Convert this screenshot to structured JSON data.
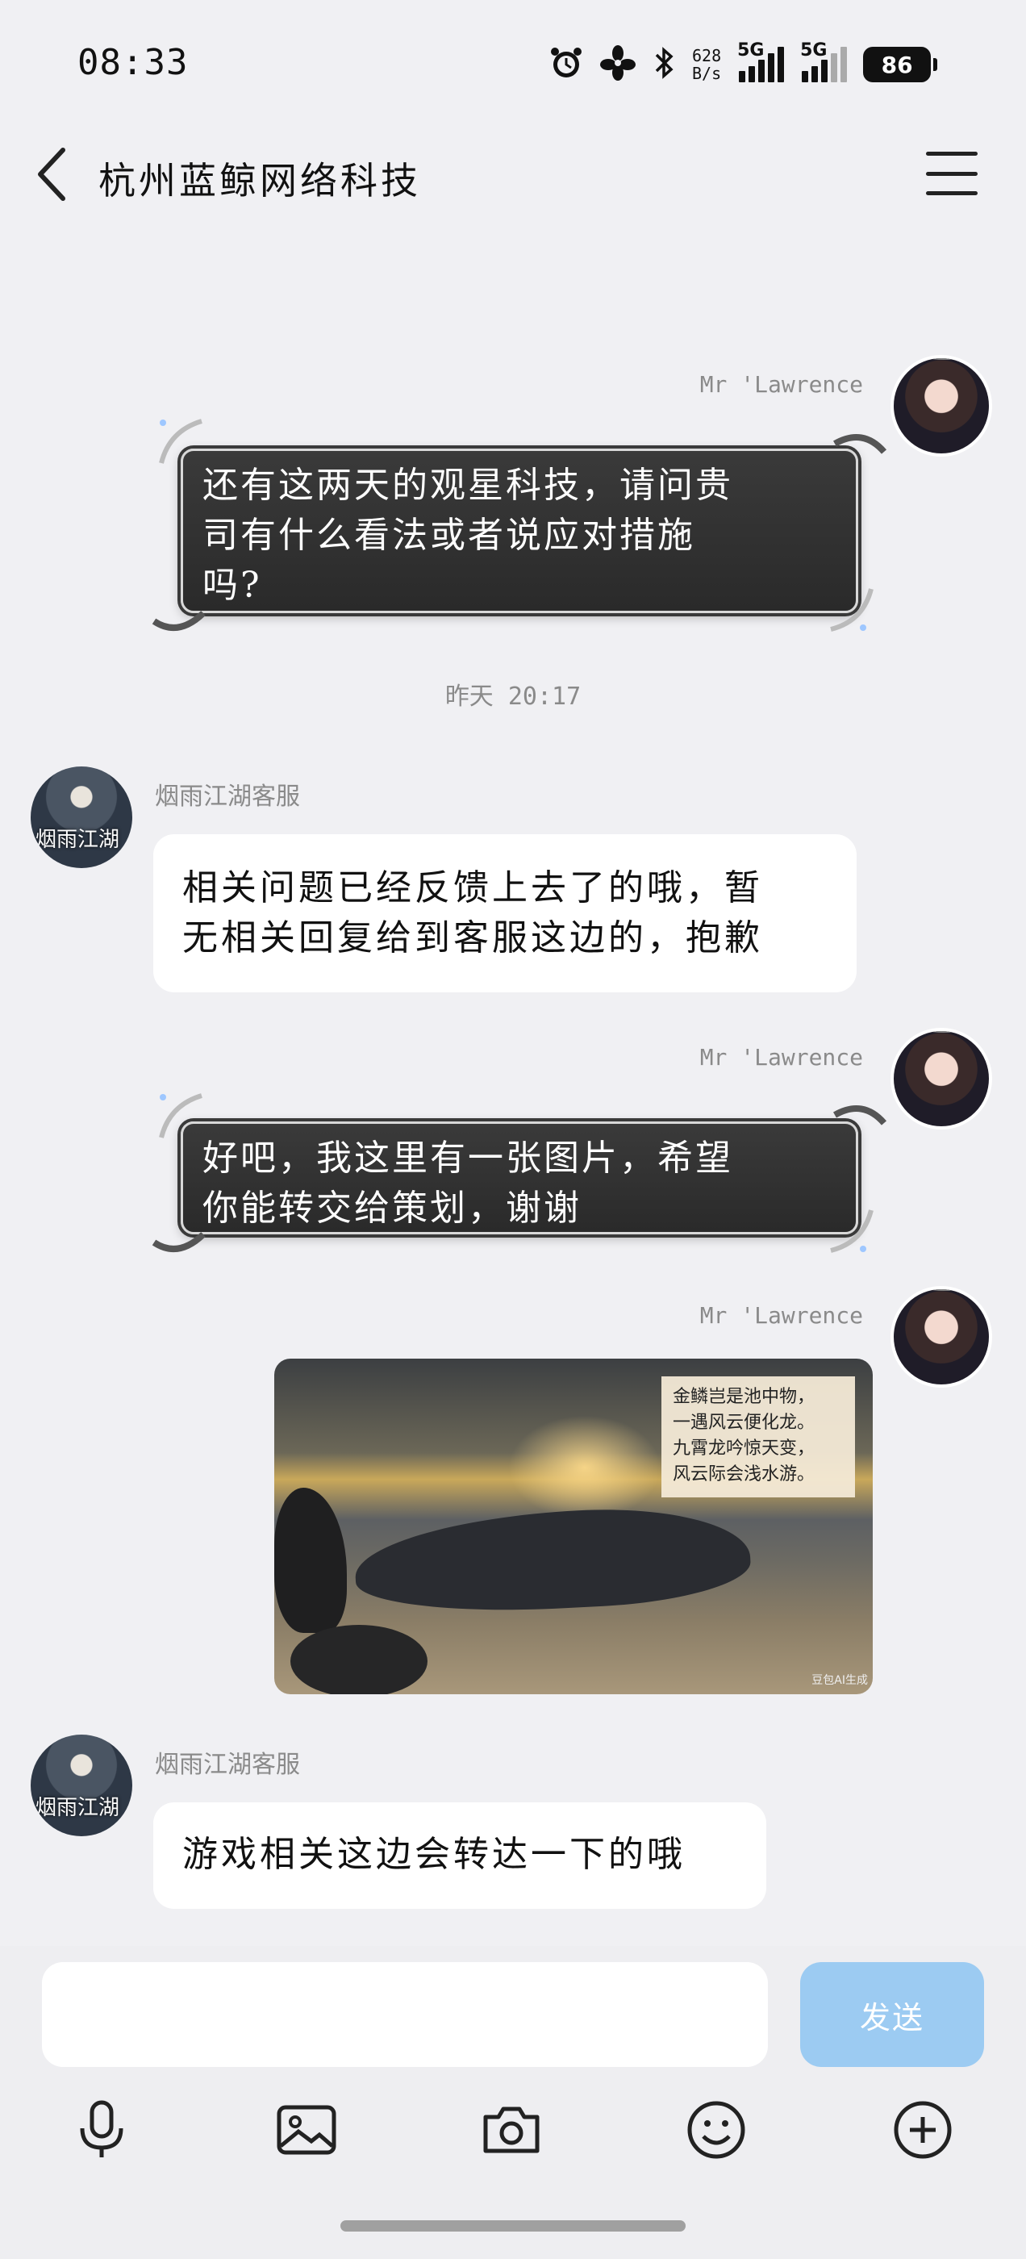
{
  "status_bar": {
    "time": "08:33",
    "net_speed_value": "628",
    "net_speed_unit": "B/s",
    "signal1_label": "5G",
    "signal2_label": "5G",
    "battery": "86"
  },
  "header": {
    "title": "杭州蓝鲸网络科技"
  },
  "messages": [
    {
      "side": "right",
      "sender": "Mr 'Lawrence",
      "text_line1": "还有这两天的观星科技，请问贵",
      "text_line2": "司有什么看法或者说应对措施",
      "text_line3": "吗?"
    },
    {
      "type": "time",
      "text": "昨天 20:17"
    },
    {
      "side": "left",
      "sender": "烟雨江湖客服",
      "text_line1": "相关问题已经反馈上去了的哦，暂",
      "text_line2": "无相关回复给到客服这边的，抱歉"
    },
    {
      "side": "right",
      "sender": "Mr 'Lawrence",
      "text_line1": "好吧，我这里有一张图片，希望",
      "text_line2": "你能转交给策划，谢谢"
    },
    {
      "side": "right",
      "sender": "Mr 'Lawrence",
      "image": {
        "poem_line1": "金鳞岂是池中物，",
        "poem_line2": "一遇风云便化龙。",
        "poem_line3": "九霄龙吟惊天变，",
        "poem_line4": "风云际会浅水游。",
        "watermark": "豆包AI生成"
      }
    },
    {
      "side": "left",
      "sender": "烟雨江湖客服",
      "text_line1": "游戏相关这边会转达一下的哦"
    }
  ],
  "avatar_cs_text": "烟雨江湖",
  "input": {
    "send_label": "发送"
  },
  "toolbar": {
    "icons": [
      "microphone-icon",
      "image-icon",
      "camera-icon",
      "emoji-icon",
      "plus-icon"
    ]
  }
}
